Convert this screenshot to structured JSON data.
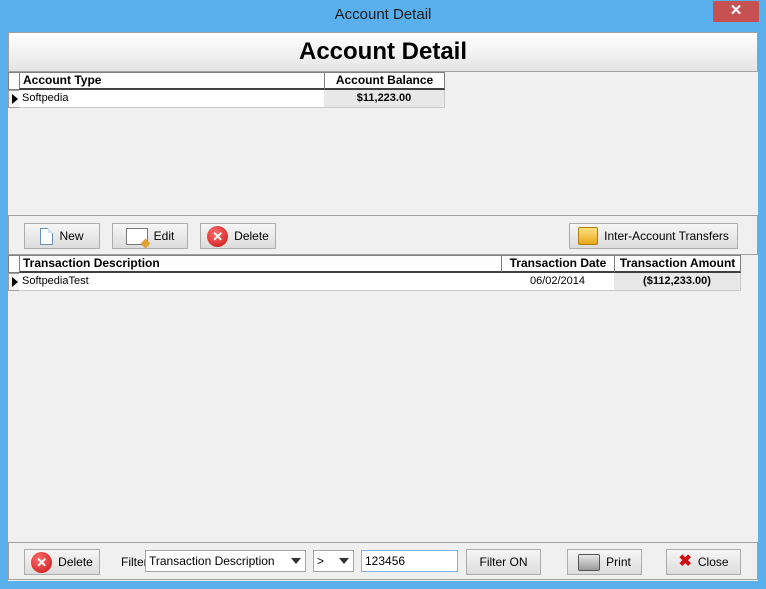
{
  "window": {
    "title": "Account Detail",
    "close_glyph": "✕"
  },
  "header": {
    "title": "Account Detail"
  },
  "accounts": {
    "columns": [
      "Account Type",
      "Account Balance"
    ],
    "rows": [
      {
        "type": "Softpedia",
        "balance": "$11,223.00"
      }
    ]
  },
  "toolbar": {
    "new_label": "New",
    "edit_label": "Edit",
    "delete_label": "Delete",
    "transfers_label": "Inter-Account Transfers"
  },
  "transactions": {
    "columns": [
      "Transaction Description",
      "Transaction Date",
      "Transaction Amount"
    ],
    "rows": [
      {
        "description": "SoftpediaTest",
        "date": "06/02/2014",
        "amount": "($112,233.00)"
      }
    ]
  },
  "bottom": {
    "delete_label": "Delete",
    "filter_label": "Filter",
    "filter_field": "Transaction Description",
    "filter_operator": ">",
    "filter_value": "123456",
    "filter_button": "Filter ON",
    "print_label": "Print",
    "close_label": "Close"
  },
  "icons": {
    "close": "close-icon",
    "new": "new-document-icon",
    "edit": "edit-icon",
    "delete": "delete-icon",
    "transfers": "transfer-icon",
    "print": "printer-icon"
  }
}
